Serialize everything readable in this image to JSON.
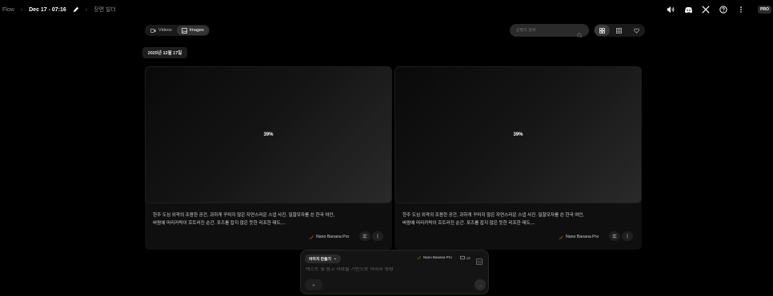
{
  "breadcrumb": {
    "root": "Flow",
    "project": "Dec 17 - 07:16",
    "scene": "장면 빌더"
  },
  "header": {
    "badge": "PRO"
  },
  "tabs": [
    {
      "label": "Videos",
      "icon": "video-icon",
      "active": false
    },
    {
      "label": "Images",
      "icon": "image-icon",
      "active": true
    }
  ],
  "search": {
    "placeholder": "콘텐츠 검색",
    "value": ""
  },
  "view_toggle": {
    "active": "grid-large"
  },
  "date_group": "2025년 12월 17일",
  "cards": [
    {
      "progress": "39%",
      "progress_value": 0.39,
      "description": "한주 도심 외곽의 조용한 공간, 과하게 꾸미지 않은 자연스러운 스냅 사진. 밀잘모자를 쓴 한국 여인, 바람에 머리카락이 흐트러진 순간. 포즈를 잡지 않은 듯한 리프한 태도,...",
      "model": "Nano Banana Pro"
    },
    {
      "progress": "39%",
      "progress_value": 0.39,
      "description": "한주 도심 외곽의 조용한 공간, 과하게 꾸미지 않은 자연스러운 스냅 사진. 밀잘모자를 쓴 한국 여인, 바람에 머리카락이 흐트러진 순간. 포즈를 잡지 않은 듯한 리프한 태도,...",
      "model": "Nano Banana Pro"
    }
  ],
  "composer": {
    "mode": "이미지 만들기",
    "model": "Nano Banana Pro",
    "ratio": "x2",
    "placeholder": "텍스트 및 참고 자료를 기반으로 이미지 생성"
  },
  "colors": {
    "background": "#000000",
    "card": "#0f0f0f",
    "chip": "#2a2a2a",
    "model_icon": "#e0a020"
  }
}
